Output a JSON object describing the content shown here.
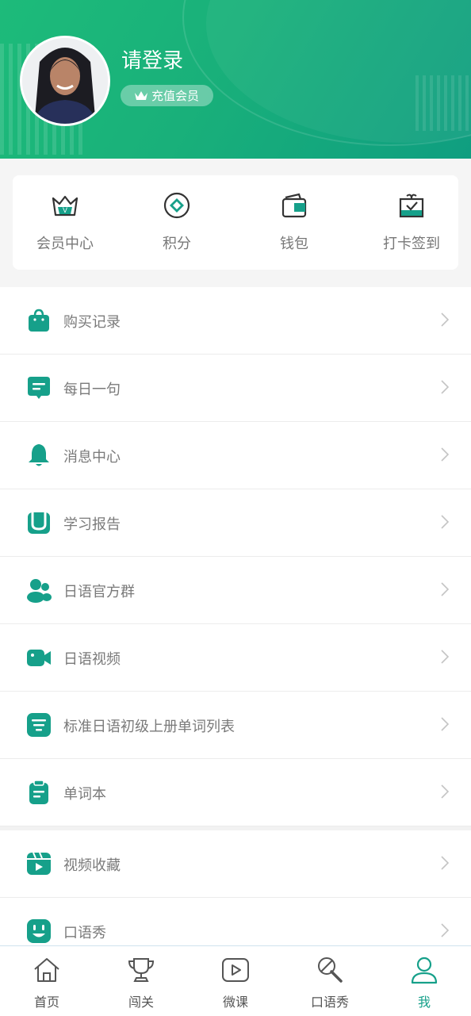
{
  "header": {
    "username": "请登录",
    "vip_label": "充值会员"
  },
  "quick_actions": [
    {
      "label": "会员中心",
      "icon": "vip-crown-icon"
    },
    {
      "label": "积分",
      "icon": "points-icon"
    },
    {
      "label": "钱包",
      "icon": "wallet-icon"
    },
    {
      "label": "打卡签到",
      "icon": "checkin-gift-icon"
    }
  ],
  "menu": [
    {
      "label": "购买记录",
      "icon": "shopping-bag-icon"
    },
    {
      "label": "每日一句",
      "icon": "message-icon"
    },
    {
      "label": "消息中心",
      "icon": "bell-icon"
    },
    {
      "label": "学习报告",
      "icon": "report-icon"
    },
    {
      "label": "日语官方群",
      "icon": "group-icon"
    },
    {
      "label": "日语视频",
      "icon": "video-camera-icon"
    },
    {
      "label": "标准日语初级上册单词列表",
      "icon": "list-icon"
    },
    {
      "label": "单词本",
      "icon": "clipboard-icon"
    },
    {
      "label": "视频收藏",
      "icon": "video-favorite-icon"
    },
    {
      "label": "口语秀",
      "icon": "smile-icon"
    }
  ],
  "tabs": [
    {
      "label": "首页",
      "icon": "home-icon",
      "active": false
    },
    {
      "label": "闯关",
      "icon": "trophy-icon",
      "active": false
    },
    {
      "label": "微课",
      "icon": "play-icon",
      "active": false
    },
    {
      "label": "口语秀",
      "icon": "microphone-icon",
      "active": false
    },
    {
      "label": "我",
      "icon": "user-icon",
      "active": true
    }
  ],
  "colors": {
    "accent": "#16a08a",
    "header_start": "#1dbb7a",
    "header_end": "#0f9e80"
  }
}
